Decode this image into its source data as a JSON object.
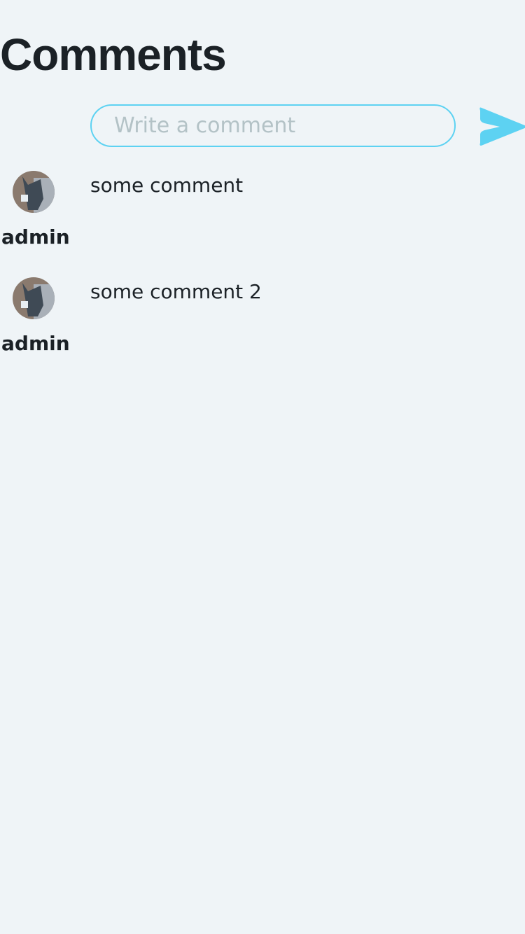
{
  "header": {
    "title": "Comments"
  },
  "composer": {
    "placeholder": "Write a comment",
    "value": "",
    "send_icon": "send-icon",
    "accent": "#5dd2f2"
  },
  "comments": [
    {
      "user": "admin",
      "text": "some comment",
      "avatar": "dog-photo"
    },
    {
      "user": "admin",
      "text": "some comment 2",
      "avatar": "dog-photo"
    }
  ]
}
